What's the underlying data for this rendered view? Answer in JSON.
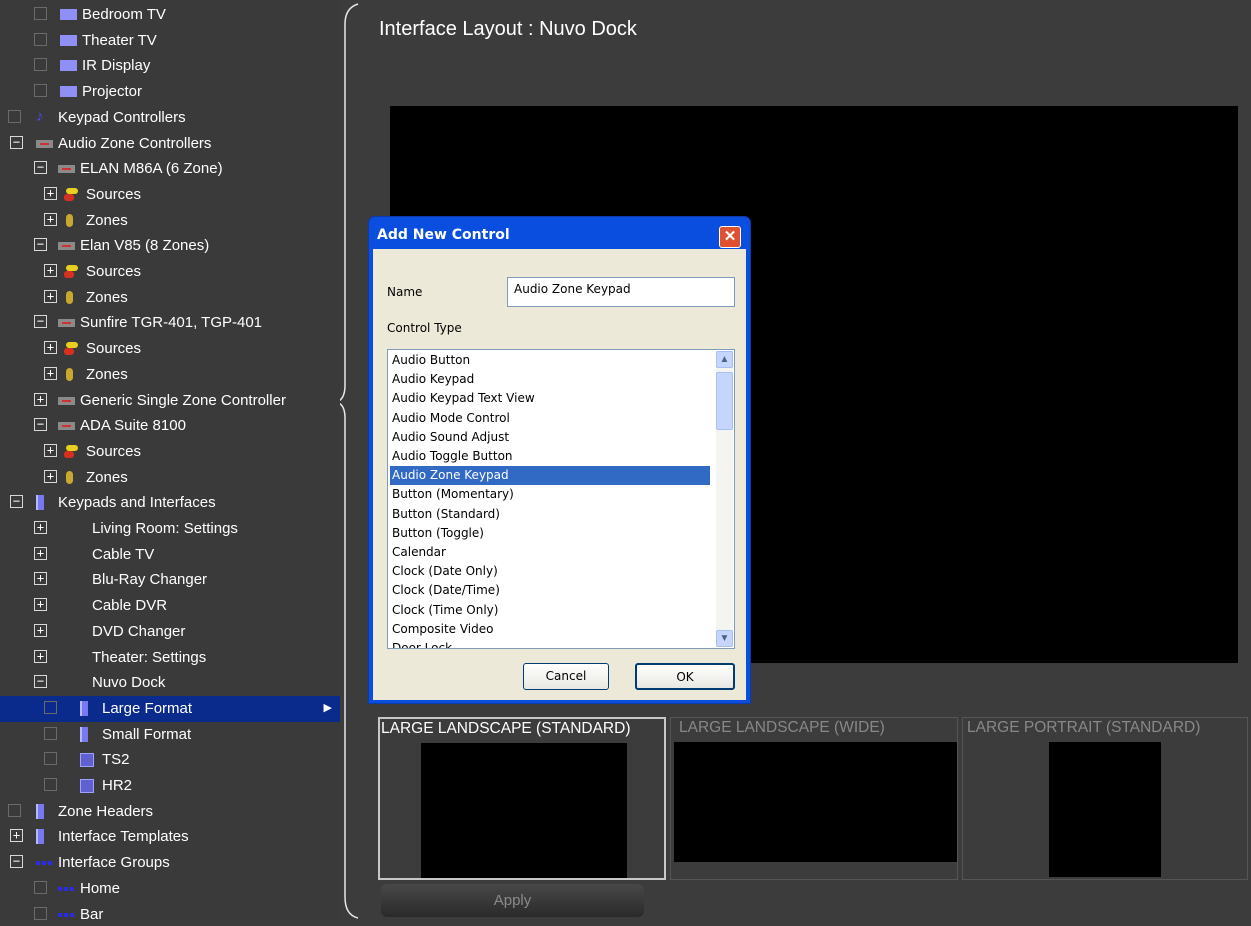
{
  "tree": {
    "items": [
      {
        "label": "Bedroom TV",
        "icon": "display-icon",
        "type": "tv",
        "level": 2,
        "check": true,
        "expander": ""
      },
      {
        "label": "Theater TV",
        "icon": "display-icon",
        "type": "tv",
        "level": 2,
        "check": true,
        "expander": ""
      },
      {
        "label": "IR Display",
        "icon": "display-icon",
        "type": "tv",
        "level": 2,
        "check": true,
        "expander": ""
      },
      {
        "label": "Projector",
        "icon": "display-icon",
        "type": "tv",
        "level": 2,
        "check": true,
        "expander": ""
      },
      {
        "label": "Keypad Controllers",
        "icon": "music-note-icon",
        "type": "note",
        "level": 1,
        "check": true,
        "expander": ""
      },
      {
        "label": "Audio Zone Controllers",
        "icon": "controller-icon",
        "type": "ctrl",
        "level": 1,
        "check": false,
        "expander": "−"
      },
      {
        "label": "ELAN M86A (6 Zone)",
        "icon": "controller-icon",
        "type": "ctrl",
        "level": 2,
        "check": false,
        "expander": "−"
      },
      {
        "label": "Sources",
        "icon": "sources-icon",
        "type": "src",
        "level": 3,
        "check": false,
        "expander": "+"
      },
      {
        "label": "Zones",
        "icon": "speaker-icon",
        "type": "zone",
        "level": 3,
        "check": false,
        "expander": "+"
      },
      {
        "label": "Elan V85 (8 Zones)",
        "icon": "controller-icon",
        "type": "ctrl",
        "level": 2,
        "check": false,
        "expander": "−"
      },
      {
        "label": "Sources",
        "icon": "sources-icon",
        "type": "src",
        "level": 3,
        "check": false,
        "expander": "+"
      },
      {
        "label": "Zones",
        "icon": "speaker-icon",
        "type": "zone",
        "level": 3,
        "check": false,
        "expander": "+"
      },
      {
        "label": "Sunfire TGR-401, TGP-401",
        "icon": "controller-icon",
        "type": "ctrl",
        "level": 2,
        "check": false,
        "expander": "−"
      },
      {
        "label": "Sources",
        "icon": "sources-icon",
        "type": "src",
        "level": 3,
        "check": false,
        "expander": "+"
      },
      {
        "label": "Zones",
        "icon": "speaker-icon",
        "type": "zone",
        "level": 3,
        "check": false,
        "expander": "+"
      },
      {
        "label": "Generic Single Zone Controller",
        "icon": "controller-icon",
        "type": "ctrl",
        "level": 2,
        "check": false,
        "expander": "+"
      },
      {
        "label": "ADA Suite 8100",
        "icon": "controller-icon",
        "type": "ctrl",
        "level": 2,
        "check": false,
        "expander": "−"
      },
      {
        "label": "Sources",
        "icon": "sources-icon",
        "type": "src",
        "level": 3,
        "check": false,
        "expander": "+"
      },
      {
        "label": "Zones",
        "icon": "speaker-icon",
        "type": "zone",
        "level": 3,
        "check": false,
        "expander": "+"
      },
      {
        "label": "Keypads and Interfaces",
        "icon": "keypad-icon",
        "type": "pad",
        "level": 1,
        "check": false,
        "expander": "−"
      },
      {
        "label": "Living Room: Settings",
        "icon": "",
        "type": "none",
        "level": 2,
        "check": false,
        "expander": "+"
      },
      {
        "label": "Cable TV",
        "icon": "",
        "type": "none",
        "level": 2,
        "check": false,
        "expander": "+"
      },
      {
        "label": "Blu-Ray Changer",
        "icon": "",
        "type": "none",
        "level": 2,
        "check": false,
        "expander": "+"
      },
      {
        "label": "Cable DVR",
        "icon": "",
        "type": "none",
        "level": 2,
        "check": false,
        "expander": "+"
      },
      {
        "label": "DVD Changer",
        "icon": "",
        "type": "none",
        "level": 2,
        "check": false,
        "expander": "+"
      },
      {
        "label": "Theater: Settings",
        "icon": "",
        "type": "none",
        "level": 2,
        "check": false,
        "expander": "+"
      },
      {
        "label": "Nuvo Dock",
        "icon": "",
        "type": "none",
        "level": 2,
        "check": false,
        "expander": "−"
      },
      {
        "label": "Large Format",
        "icon": "keypad-icon",
        "type": "pad",
        "level": 3,
        "check": true,
        "expander": "",
        "selected": true
      },
      {
        "label": "Small Format",
        "icon": "keypad-icon",
        "type": "pad",
        "level": 3,
        "check": true,
        "expander": ""
      },
      {
        "label": "TS2",
        "icon": "touchscreen-icon",
        "type": "pic",
        "level": 3,
        "check": true,
        "expander": ""
      },
      {
        "label": "HR2",
        "icon": "touchscreen-icon",
        "type": "pic",
        "level": 3,
        "check": true,
        "expander": ""
      },
      {
        "label": "Zone Headers",
        "icon": "keypad-icon",
        "type": "pad",
        "level": 1,
        "check": true,
        "expander": ""
      },
      {
        "label": "Interface Templates",
        "icon": "keypad-icon",
        "type": "pad",
        "level": 1,
        "check": false,
        "expander": "+"
      },
      {
        "label": "Interface Groups",
        "icon": "group-icon",
        "type": "grp",
        "level": 1,
        "check": false,
        "expander": "−"
      },
      {
        "label": "Home",
        "icon": "group-icon",
        "type": "grp",
        "level": 2,
        "check": true,
        "expander": ""
      },
      {
        "label": "Bar",
        "icon": "group-icon",
        "type": "grp",
        "level": 2,
        "check": true,
        "expander": ""
      }
    ]
  },
  "main": {
    "title": "Interface Layout : Nuvo Dock",
    "layouts": [
      {
        "label": "LARGE LANDSCAPE (STANDARD)",
        "active": true
      },
      {
        "label": "LARGE LANDSCAPE (WIDE)",
        "active": false
      },
      {
        "label": "LARGE PORTRAIT (STANDARD)",
        "active": false
      }
    ],
    "apply_label": "Apply"
  },
  "dialog": {
    "title": "Add New Control",
    "close_glyph": "✕",
    "name_label": "Name",
    "name_value": "Audio Zone Keypad",
    "type_label": "Control Type",
    "options": [
      "Audio Button",
      "Audio Keypad",
      "Audio Keypad Text View",
      "Audio Mode Control",
      "Audio Sound Adjust",
      "Audio Toggle Button",
      "Audio Zone Keypad",
      "Button (Momentary)",
      "Button (Standard)",
      "Button (Toggle)",
      "Calendar",
      "Clock (Date Only)",
      "Clock (Date/Time)",
      "Clock (Time Only)",
      "Composite Video",
      "Door Lock"
    ],
    "selected_option": "Audio Zone Keypad",
    "cancel_label": "Cancel",
    "ok_label": "OK"
  }
}
